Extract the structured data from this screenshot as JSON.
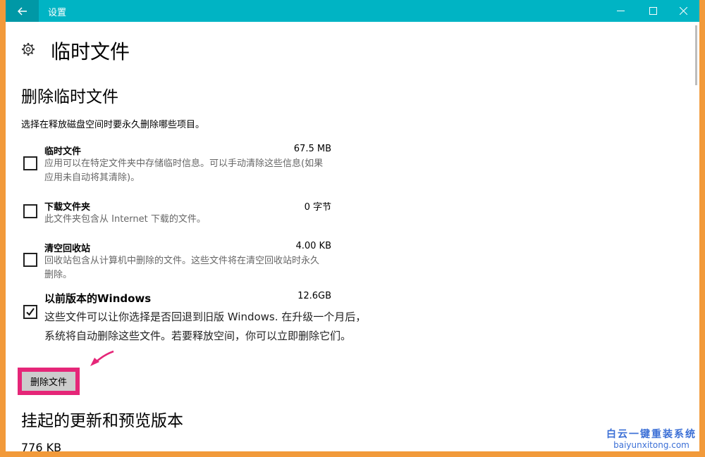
{
  "window": {
    "title": "设置"
  },
  "page": {
    "title": "临时文件"
  },
  "section": {
    "title": "删除临时文件",
    "description": "选择在释放磁盘空间时要永久删除哪些项目。"
  },
  "items": [
    {
      "name": "临时文件",
      "size": "67.5 MB",
      "desc": "应用可以在特定文件夹中存储临时信息。可以手动清除这些信息(如果应用未自动将其清除)。",
      "checked": false
    },
    {
      "name": "下载文件夹",
      "size": "0 字节",
      "desc": "此文件夹包含从 Internet 下载的文件。",
      "checked": false
    },
    {
      "name": "清空回收站",
      "size": "4.00 KB",
      "desc": "回收站包含从计算机中删除的文件。这些文件将在清空回收站时永久删除。",
      "checked": false
    },
    {
      "name": "以前版本的Windows",
      "size": "12.6GB",
      "desc": "这些文件可以让你选择是否回退到旧版 Windows. 在升级一个月后，系统将自动删除这些文件。若要释放空间，你可以立即删除它们。",
      "checked": true
    }
  ],
  "delete_button": {
    "label": "删除文件"
  },
  "section2": {
    "title": "挂起的更新和预览版本",
    "size": "776 KB"
  },
  "watermark": {
    "top": "白云一键重装系统",
    "bottom": "baiyunxitong.com"
  },
  "colors": {
    "titlebar": "#00b4c4",
    "back_button": "#0098a6",
    "highlight": "#e52678",
    "frame": "#f29a3a"
  },
  "icons": {
    "back": "arrow-left-icon",
    "minimize": "minimize-icon",
    "maximize": "maximize-icon",
    "close": "close-icon",
    "page": "gear-icon",
    "check": "checkmark-icon"
  }
}
